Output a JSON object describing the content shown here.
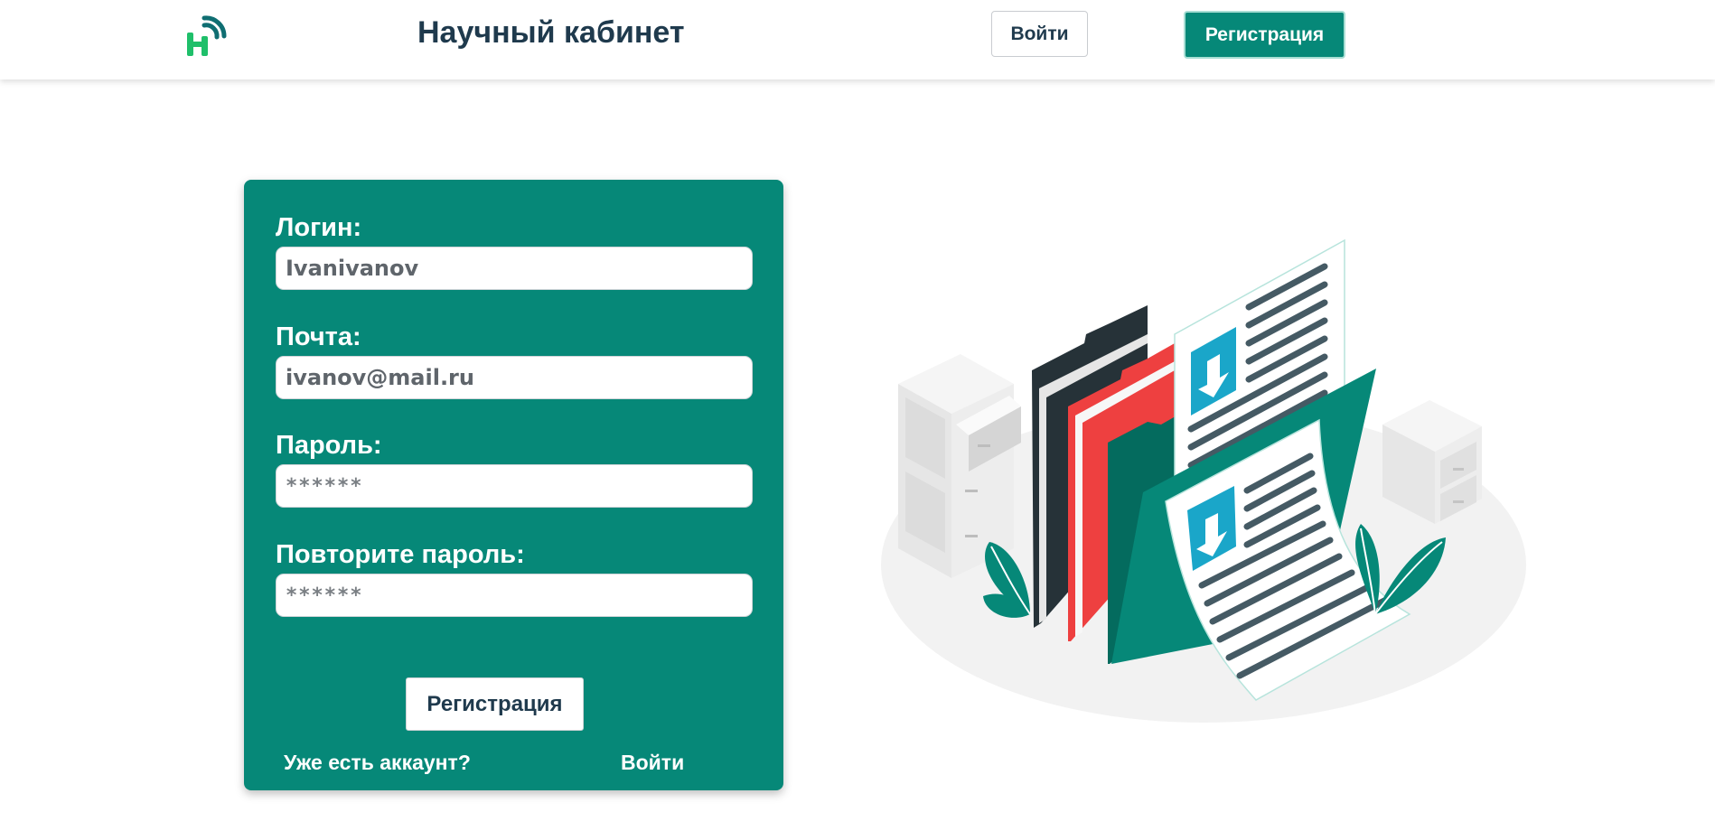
{
  "header": {
    "logo_icon": "hmc-wifi-logo-icon",
    "title": "Научный кабинет",
    "login_label": "Войти",
    "register_label": "Регистрация"
  },
  "form": {
    "login_label": "Логин:",
    "login_value": "Ivanivanov",
    "email_label": "Почта:",
    "email_value": "ivanov@mail.ru",
    "password_label": "Пароль:",
    "password_value": "******",
    "repeat_label": "Повторите пароль:",
    "repeat_value": "******",
    "submit_label": "Регистрация",
    "have_account_text": "Уже есть аккаунт?",
    "login_link_label": "Войти"
  },
  "illustration": {
    "icon": "documents-folders-illustration"
  },
  "colors": {
    "accent": "#068878",
    "dark_text": "#1f3a4d",
    "logo_green": "#1fbf6a",
    "folder_red": "#ee4040",
    "folder_dark": "#263238",
    "download_blue": "#1aa6c9"
  }
}
